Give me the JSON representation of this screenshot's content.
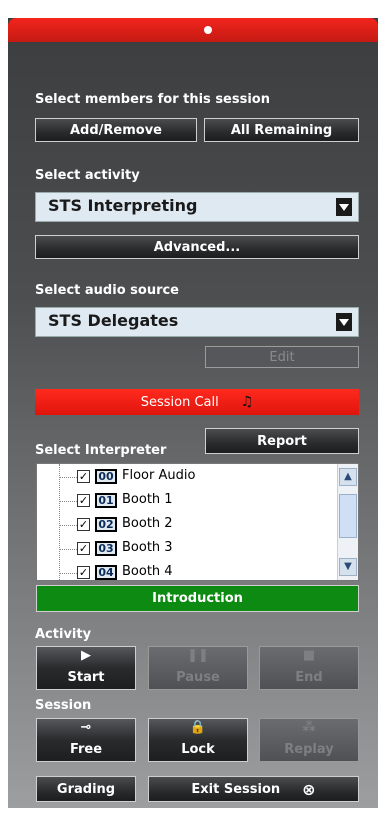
{
  "members": {
    "label": "Select members for this session",
    "add_remove": "Add/Remove",
    "all_remaining": "All Remaining"
  },
  "activity_select": {
    "label": "Select activity",
    "value": "STS Interpreting",
    "advanced": "Advanced..."
  },
  "audio": {
    "label": "Select audio source",
    "value": "STS Delegates",
    "edit": "Edit"
  },
  "session_call": "Session Call",
  "interpreter": {
    "label": "Select Interpreter",
    "report": "Report",
    "items": [
      {
        "num": "00",
        "name": "Floor Audio",
        "checked": true
      },
      {
        "num": "01",
        "name": "Booth 1",
        "checked": true
      },
      {
        "num": "02",
        "name": "Booth 2",
        "checked": true
      },
      {
        "num": "03",
        "name": "Booth 3",
        "checked": true
      },
      {
        "num": "04",
        "name": "Booth 4",
        "checked": true
      }
    ],
    "introduction": "Introduction"
  },
  "activity_controls": {
    "label": "Activity",
    "start": "Start",
    "pause": "Pause",
    "end": "End"
  },
  "session_controls": {
    "label": "Session",
    "free": "Free",
    "lock": "Lock",
    "replay": "Replay"
  },
  "footer": {
    "grading": "Grading",
    "exit": "Exit Session"
  },
  "colors": {
    "titlebar": "#e0201a",
    "session_call": "#ff2a1e",
    "introduction": "#0d8a12"
  }
}
